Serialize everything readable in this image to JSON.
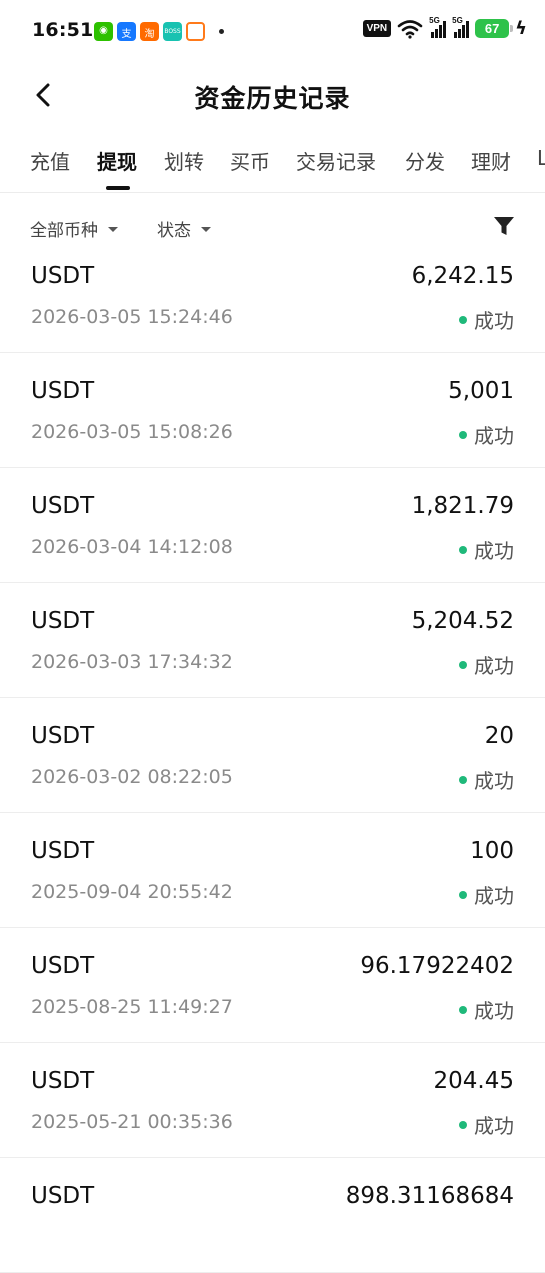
{
  "status_bar": {
    "time": "16:51",
    "app_icons": [
      {
        "name": "wechat-icon",
        "glyph": "◉"
      },
      {
        "name": "alipay-icon",
        "glyph": "支"
      },
      {
        "name": "taobao-icon",
        "glyph": "淘"
      },
      {
        "name": "boss-icon",
        "glyph": "BOSS"
      },
      {
        "name": "didi-icon",
        "glyph": ""
      }
    ],
    "vpn": "VPN",
    "signal_label_1": "5G",
    "signal_label_2": "5G",
    "battery": "67"
  },
  "header": {
    "title": "资金历史记录",
    "back_icon": "chevron-left-icon"
  },
  "tabs": [
    {
      "label": "充值",
      "active": false
    },
    {
      "label": "提现",
      "active": true
    },
    {
      "label": "划转",
      "active": false
    },
    {
      "label": "买币",
      "active": false
    },
    {
      "label": "交易记录",
      "active": false
    },
    {
      "label": "分发",
      "active": false
    },
    {
      "label": "理财",
      "active": false
    },
    {
      "label": "L",
      "active": false
    }
  ],
  "filters": {
    "currency": "全部币种",
    "status": "状态",
    "filter_icon": "funnel-icon"
  },
  "colors": {
    "success": "#1fb97a",
    "text_primary": "#111111",
    "text_secondary": "#8a8a8a"
  },
  "records": [
    {
      "coin": "USDT",
      "amount": "6,242.15",
      "time": "2026-03-05 15:24:46",
      "status": "成功"
    },
    {
      "coin": "USDT",
      "amount": "5,001",
      "time": "2026-03-05 15:08:26",
      "status": "成功"
    },
    {
      "coin": "USDT",
      "amount": "1,821.79",
      "time": "2026-03-04 14:12:08",
      "status": "成功"
    },
    {
      "coin": "USDT",
      "amount": "5,204.52",
      "time": "2026-03-03 17:34:32",
      "status": "成功"
    },
    {
      "coin": "USDT",
      "amount": "20",
      "time": "2026-03-02 08:22:05",
      "status": "成功"
    },
    {
      "coin": "USDT",
      "amount": "100",
      "time": "2025-09-04 20:55:42",
      "status": "成功"
    },
    {
      "coin": "USDT",
      "amount": "96.17922402",
      "time": "2025-08-25 11:49:27",
      "status": "成功"
    },
    {
      "coin": "USDT",
      "amount": "204.45",
      "time": "2025-05-21 00:35:36",
      "status": "成功"
    },
    {
      "coin": "USDT",
      "amount": "898.31168684",
      "time": "",
      "status": ""
    }
  ]
}
